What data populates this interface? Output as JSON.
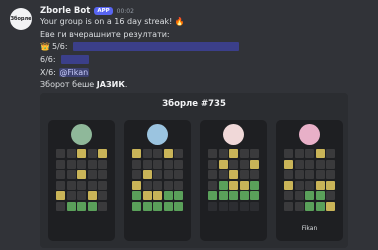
{
  "bot": {
    "avatar_text": "Збoрле",
    "username": "Zborle Bot",
    "badge": "APP",
    "timestamp": "00:02"
  },
  "message": {
    "streak_text": "Your group is on a 16 day streak!",
    "streak_emoji": "🔥",
    "results_heading": "Еве ги вчерашните резултати:",
    "lines": [
      {
        "prefix_icon": "👑",
        "score": "5/6:"
      },
      {
        "score": "6/6:"
      },
      {
        "score": "X/6:",
        "mention": "@Fikan"
      }
    ],
    "word_prefix": "Зборот беше ",
    "word": "ЈАЗИК",
    "word_suffix": "."
  },
  "colors": {
    "green": "#5aa05a",
    "yellow": "#c9b458",
    "gray": "#3a3a3c",
    "empty": "#2c2d31"
  },
  "embed": {
    "title": "Зборле #735",
    "cards": [
      {
        "name": "",
        "avatar_color": "#8fb89a",
        "grid": [
          "ggygy",
          "ggggg",
          "ggygg",
          "ggggg",
          "yggyg",
          "gGGGg"
        ]
      },
      {
        "name": "",
        "avatar_color": "#9bc4e0",
        "grid": [
          "yggyg",
          "ggggg",
          "gyggg",
          "ygggg",
          "GyyGG",
          "GGGGG"
        ]
      },
      {
        "name": "",
        "avatar_color": "#f0d8d8",
        "grid": [
          "ggygg",
          "gyggy",
          "ggygg",
          "gGyyG",
          "GGGGG",
          "....."
        ]
      },
      {
        "name": "Fikan",
        "avatar_color": "#e8b0c8",
        "grid": [
          "gggyg",
          "ygggg",
          "ggggg",
          "yggyy",
          "ggGGg",
          "ggGGy"
        ]
      }
    ]
  }
}
